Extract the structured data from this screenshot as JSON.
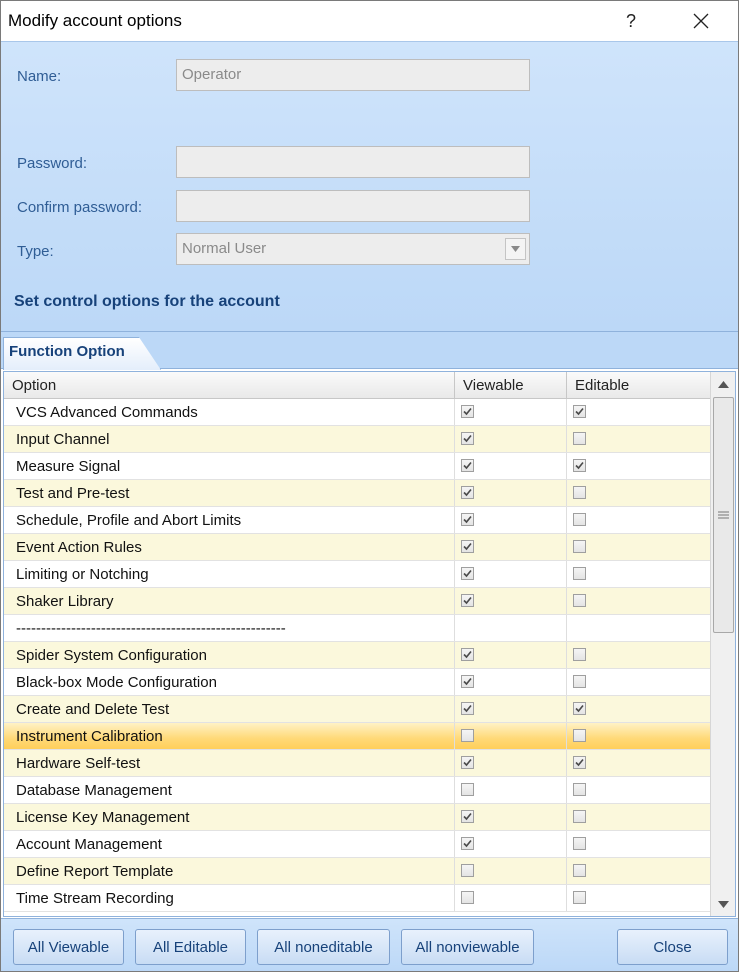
{
  "window": {
    "title": "Modify account options",
    "help_glyph": "?"
  },
  "form": {
    "name_label": "Name:",
    "name_value": "Operator",
    "password_label": "Password:",
    "password_value": "",
    "confirm_label": "Confirm password:",
    "confirm_value": "",
    "type_label": "Type:",
    "type_value": "Normal User",
    "section_title": "Set control options for the account"
  },
  "tabs": [
    {
      "label": "Function Option",
      "active": true
    }
  ],
  "grid": {
    "columns": [
      "Option",
      "Viewable",
      "Editable"
    ],
    "rows": [
      {
        "option": "VCS Advanced Commands",
        "viewable": true,
        "editable": true,
        "has_checks": true
      },
      {
        "option": "Input Channel",
        "viewable": true,
        "editable": false,
        "has_checks": true
      },
      {
        "option": "Measure Signal",
        "viewable": true,
        "editable": true,
        "has_checks": true
      },
      {
        "option": "Test and Pre-test",
        "viewable": true,
        "editable": false,
        "has_checks": true
      },
      {
        "option": "Schedule, Profile and Abort Limits",
        "viewable": true,
        "editable": false,
        "has_checks": true
      },
      {
        "option": "Event Action Rules",
        "viewable": true,
        "editable": false,
        "has_checks": true
      },
      {
        "option": "Limiting or Notching",
        "viewable": true,
        "editable": false,
        "has_checks": true
      },
      {
        "option": "Shaker Library",
        "viewable": true,
        "editable": false,
        "has_checks": true
      },
      {
        "option": "------------------------------------------------------",
        "viewable": false,
        "editable": false,
        "has_checks": false
      },
      {
        "option": "Spider System Configuration",
        "viewable": true,
        "editable": false,
        "has_checks": true
      },
      {
        "option": "Black-box Mode Configuration",
        "viewable": true,
        "editable": false,
        "has_checks": true
      },
      {
        "option": "Create and Delete Test",
        "viewable": true,
        "editable": true,
        "has_checks": true
      },
      {
        "option": "Instrument Calibration",
        "viewable": false,
        "editable": false,
        "has_checks": true,
        "selected": true
      },
      {
        "option": "Hardware Self-test",
        "viewable": true,
        "editable": true,
        "has_checks": true
      },
      {
        "option": "Database Management",
        "viewable": false,
        "editable": false,
        "has_checks": true
      },
      {
        "option": "License Key Management",
        "viewable": true,
        "editable": false,
        "has_checks": true
      },
      {
        "option": "Account Management",
        "viewable": true,
        "editable": false,
        "has_checks": true
      },
      {
        "option": "Define Report Template",
        "viewable": false,
        "editable": false,
        "has_checks": true
      },
      {
        "option": "Time Stream Recording",
        "viewable": false,
        "editable": false,
        "has_checks": true
      }
    ]
  },
  "buttons": {
    "all_viewable": "All Viewable",
    "all_editable": "All Editable",
    "all_noneditable": "All noneditable",
    "all_nonviewable": "All nonviewable",
    "close": "Close"
  },
  "icons": {
    "close": "close-icon",
    "dropdown": "chevron-down-icon",
    "scroll_up": "arrow-up-icon",
    "scroll_down": "arrow-down-icon",
    "checkbox": "check-icon"
  },
  "colors": {
    "panel_blue": "#c6ddf8",
    "label_blue": "#2f5d95",
    "accent_navy": "#17427a",
    "alt_row": "#fbf8dc",
    "selected_row": "#ffd977"
  }
}
